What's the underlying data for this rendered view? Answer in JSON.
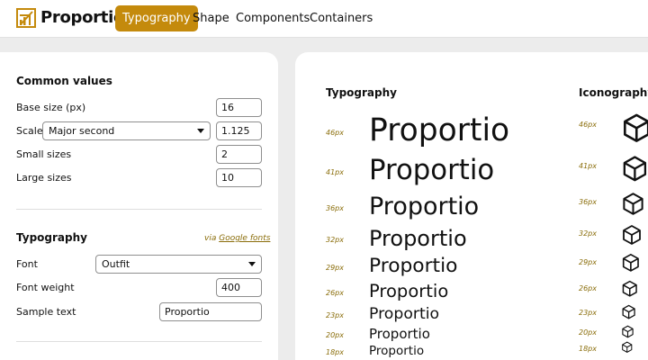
{
  "brand": {
    "name": "Proportio",
    "accent": "#c48a0c"
  },
  "nav": [
    {
      "label": "Typography",
      "active": true
    },
    {
      "label": "Shape",
      "active": false
    },
    {
      "label": "Components",
      "active": false
    },
    {
      "label": "Containers",
      "active": false
    }
  ],
  "common": {
    "title": "Common values",
    "base_size_label": "Base size (px)",
    "base_size_value": "16",
    "scale_label": "Scale",
    "scale_select": "Major second",
    "scale_value": "1.125",
    "small_label": "Small sizes",
    "small_value": "2",
    "large_label": "Large sizes",
    "large_value": "10"
  },
  "typography": {
    "title": "Typography",
    "via": "via",
    "via_link": "Google fonts",
    "font_label": "Font",
    "font_value": "Outfit",
    "weight_label": "Font weight",
    "weight_value": "400",
    "sample_label": "Sample text",
    "sample_value": "Proportio"
  },
  "preview": {
    "typography_heading": "Typography",
    "iconography_heading": "Iconography",
    "sample_text": "Proportio",
    "icon": "cube-icon",
    "sizes": [
      "46px",
      "41px",
      "36px",
      "32px",
      "29px",
      "26px",
      "23px",
      "20px",
      "18px"
    ]
  }
}
